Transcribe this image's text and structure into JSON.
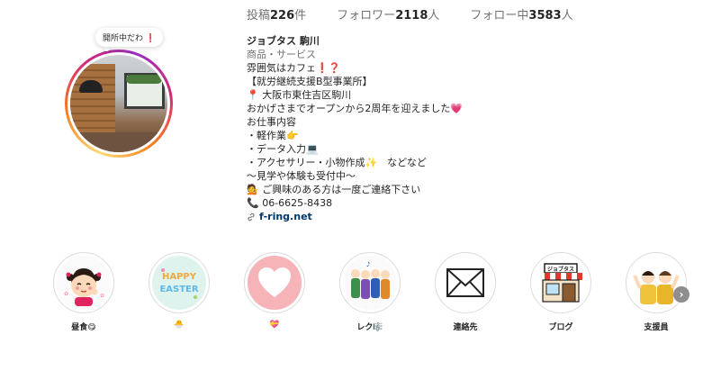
{
  "stats": {
    "posts_label": "投稿",
    "posts_count": "226",
    "posts_unit": "件",
    "followers_label": "フォロワー",
    "followers_count": "2118",
    "followers_unit": "人",
    "following_label": "フォロー中",
    "following_count": "3583",
    "following_unit": "人"
  },
  "note": {
    "text": "開所中だわ",
    "mark": "❗"
  },
  "profile": {
    "name": "ジョブタス 駒川",
    "category": "商品・サービス",
    "bio_lines": [
      "雰囲気はカフェ❗❓",
      "【就労継続支援B型事業所】",
      "📍 大阪市東住吉区駒川",
      "おかげさまでオープンから2周年を迎えました💗",
      "お仕事内容",
      "・軽作業👉",
      "・データ入力💻",
      "・アクセサリー・小物作成✨　などなど",
      "〜見学や体験も受付中〜",
      "💁 ご興味のある方は一度ご連絡下さい",
      "📞 06-6625-8438"
    ],
    "link": "f-ring.net"
  },
  "highlights": [
    {
      "label": "昼食😋"
    },
    {
      "label": "🐣"
    },
    {
      "label": "💝"
    },
    {
      "label": "レク🎼"
    },
    {
      "label": "連絡先"
    },
    {
      "label": "ブログ"
    },
    {
      "label": "支援員"
    }
  ],
  "shop_sign": "ジョブタス",
  "easter_text": {
    "line1": "HAPPY",
    "line2": "EASTER"
  },
  "icons": [
    "link-icon",
    "mail-icon",
    "chevron-right-icon"
  ],
  "colors": {
    "link": "#00376b",
    "muted": "#737373",
    "accent_red": "#e0245e"
  }
}
